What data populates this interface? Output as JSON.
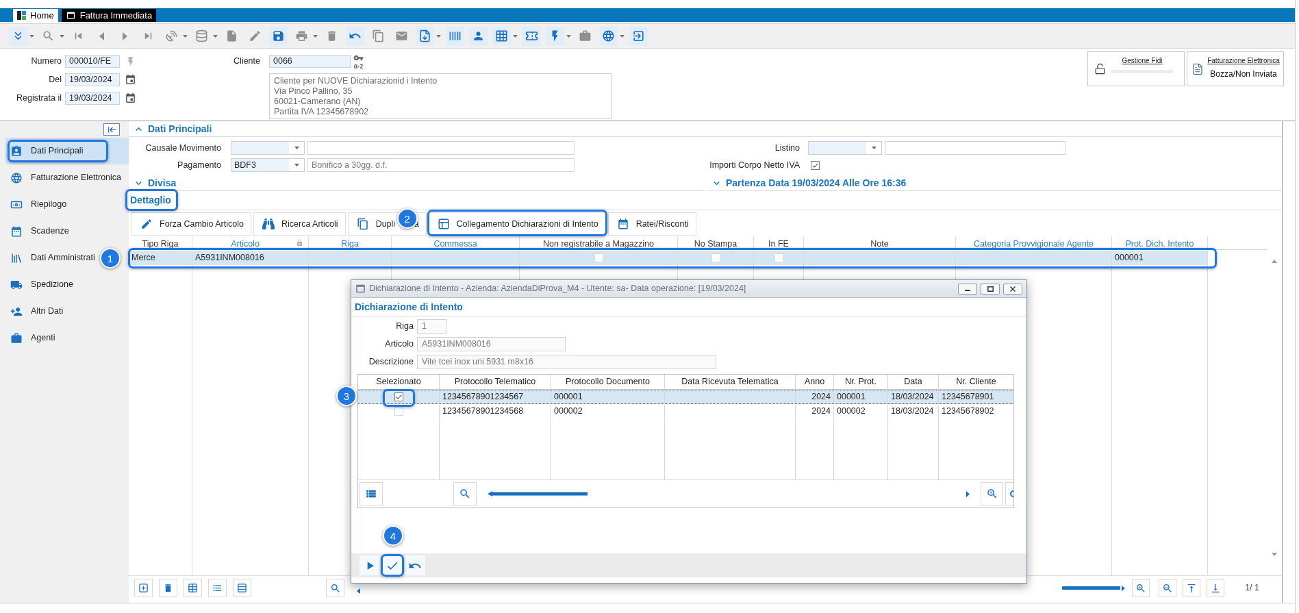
{
  "tabs": [
    {
      "label": "Home",
      "selected": false
    },
    {
      "label": "Fattura Immediata",
      "selected": true
    }
  ],
  "toolbar": [
    {
      "enabled": true,
      "menu": true
    },
    {
      "enabled": false,
      "menu": true
    },
    {
      "enabled": false,
      "menu": false
    },
    {
      "enabled": false,
      "menu": false
    },
    {
      "enabled": false,
      "menu": false
    },
    {
      "enabled": false,
      "menu": false
    },
    {
      "enabled": false,
      "menu": true
    },
    {
      "enabled": false,
      "menu": true
    },
    {
      "enabled": false,
      "menu": false
    },
    {
      "enabled": false,
      "menu": false
    },
    {
      "enabled": true,
      "menu": false
    },
    {
      "enabled": false,
      "menu": true
    },
    {
      "enabled": false,
      "menu": false
    },
    {
      "enabled": true,
      "menu": false
    },
    {
      "enabled": false,
      "menu": false
    },
    {
      "enabled": false,
      "menu": false
    },
    {
      "enabled": true,
      "menu": true
    },
    {
      "enabled": true,
      "menu": false
    },
    {
      "enabled": true,
      "menu": false
    },
    {
      "enabled": true,
      "menu": true
    },
    {
      "enabled": true,
      "menu": false
    },
    {
      "enabled": true,
      "menu": true
    },
    {
      "enabled": false,
      "menu": false
    },
    {
      "enabled": true,
      "menu": true
    },
    {
      "enabled": true,
      "menu": false
    }
  ],
  "header": {
    "fields": [
      {
        "label": "Numero",
        "value": "000010/FE",
        "kind": "code"
      },
      {
        "label": "Del",
        "value": "19/03/2024",
        "kind": "date"
      },
      {
        "label": "Registrata il",
        "value": "19/03/2024",
        "kind": "date"
      }
    ],
    "customer": {
      "label": "Cliente",
      "value": "0066",
      "lookup_label": "a-z",
      "address": [
        "Cliente per NUOVE Dichiarazionid i Intento",
        "Via Pinco Pallino, 35",
        "60021-Camerano (AN)",
        "Partita IVA 12345678902"
      ]
    },
    "credit": {
      "title": "Gestione Fidi"
    },
    "e_invoice": {
      "title": "Fatturazione Elettronica",
      "status": "Bozza/Non Inviata"
    }
  },
  "sidebar": {
    "items": [
      {
        "label": "Dati Principali",
        "selected": true,
        "highlighted": true
      },
      {
        "label": "Fatturazione Elettronica",
        "selected": false,
        "highlighted": false
      },
      {
        "label": "Riepilogo",
        "selected": false,
        "highlighted": false
      },
      {
        "label": "Scadenze",
        "selected": false,
        "highlighted": false
      },
      {
        "label": "Dati Amministrati",
        "selected": false,
        "highlighted": false
      },
      {
        "label": "Spedizione",
        "selected": false,
        "highlighted": false
      },
      {
        "label": "Altri Dati",
        "selected": false,
        "highlighted": false
      },
      {
        "label": "Agenti",
        "selected": false,
        "highlighted": false
      }
    ]
  },
  "main_section": {
    "title": "Dati Principali",
    "expanded": true,
    "left_fields": [
      {
        "label": "Causale Movimento",
        "kind": "combo"
      },
      {
        "label": "Pagamento",
        "kind": "combo",
        "code": "BDF3",
        "description": "Bonifico a 30gg. d.f."
      }
    ],
    "right_fields": [
      {
        "label": "Listino",
        "kind": "combo"
      },
      {
        "label": "Importi Corpo Netto IVA",
        "kind": "checkbox",
        "checked": true
      }
    ]
  },
  "collapsed_sections": [
    {
      "title": "Divisa",
      "expanded": false
    },
    {
      "title": "Partenza Data 19/03/2024 Alle Ore 16:36",
      "expanded": false
    }
  ],
  "detail": {
    "title": "Dettaglio",
    "highlighted": true,
    "buttons": [
      {
        "label": "Forza Cambio Articolo",
        "highlighted": false
      },
      {
        "label": "Ricerca Articoli",
        "highlighted": false
      },
      {
        "label": "Dupli",
        "label_end": "a",
        "highlighted": false
      },
      {
        "label": "Collegamento Dichiarazioni di Intento",
        "highlighted": true,
        "callout": "2"
      },
      {
        "label": "Ratei/Risconti",
        "highlighted": false
      }
    ],
    "table": {
      "columns": [
        {
          "label": "Tipo Riga",
          "linked": false,
          "locked": false
        },
        {
          "label": "Articolo",
          "linked": true,
          "locked": true
        },
        {
          "label": "Riga",
          "linked": true,
          "locked": false
        },
        {
          "label": "Commessa",
          "linked": true,
          "locked": false
        },
        {
          "label": "Non registrabile a Magazzino",
          "linked": false,
          "locked": false
        },
        {
          "label": "No Stampa",
          "linked": false,
          "locked": false
        },
        {
          "label": "In FE",
          "linked": false,
          "locked": false
        },
        {
          "label": "Note",
          "linked": false,
          "locked": false
        },
        {
          "label": "Categoria Provvigionale Agente",
          "linked": true,
          "locked": false
        },
        {
          "label": "Prot. Dich. Intento",
          "linked": true,
          "locked": false
        }
      ],
      "rows": [
        {
          "selected": true,
          "highlighted": true,
          "callout": "1",
          "cells": [
            {
              "text": "Merce"
            },
            {
              "text": "A5931INM008016"
            },
            {},
            {},
            {
              "checked": false
            },
            {
              "checked": false
            },
            {
              "checked": false
            },
            {},
            {},
            {
              "text": "000001"
            }
          ]
        }
      ]
    },
    "pager": "1/ 1"
  },
  "dialog": {
    "title": "Dichiarazione di Intento - Azienda: AziendaDiProva_M4 - Utente: sa- Data operazione: [19/03/2024]",
    "heading": "Dichiarazione di Intento",
    "fields": [
      {
        "label": "Riga",
        "value": "1"
      },
      {
        "label": "Articolo",
        "value": "A5931INM008016"
      },
      {
        "label": "Descrizione",
        "value": "Vite tcei inox uni 5931 m8x16"
      }
    ],
    "grid": {
      "columns": [
        {
          "label": "Selezionato",
          "kind": "check"
        },
        {
          "label": "Protocollo Telematico",
          "kind": "text"
        },
        {
          "label": "Protocollo Documento",
          "kind": "text"
        },
        {
          "label": "Data Ricevuta Telematica",
          "kind": "text"
        },
        {
          "label": "Anno",
          "kind": "number"
        },
        {
          "label": "Nr. Prot.",
          "kind": "text"
        },
        {
          "label": "Data",
          "kind": "text"
        },
        {
          "label": "Nr. Cliente",
          "kind": "text"
        }
      ],
      "rows": [
        {
          "selected": true,
          "highlighted": true,
          "callout": "3",
          "cells": [
            {
              "checked": true
            },
            {
              "text": "12345678901234567"
            },
            {
              "text": "000001"
            },
            {},
            {
              "text": "2024"
            },
            {
              "text": "000001"
            },
            {
              "text": "18/03/2024"
            },
            {
              "text": "12345678901"
            }
          ]
        },
        {
          "selected": false,
          "highlighted": false,
          "cells": [
            {
              "checked": false
            },
            {
              "text": "12345678901234568"
            },
            {
              "text": "000002"
            },
            {},
            {
              "text": "2024"
            },
            {
              "text": "000002"
            },
            {
              "text": "18/03/2024"
            },
            {
              "text": "12345678902"
            }
          ]
        }
      ]
    },
    "footer_buttons": [
      {
        "highlighted": false
      },
      {
        "highlighted": true,
        "callout": "4"
      },
      {
        "highlighted": false
      }
    ]
  }
}
